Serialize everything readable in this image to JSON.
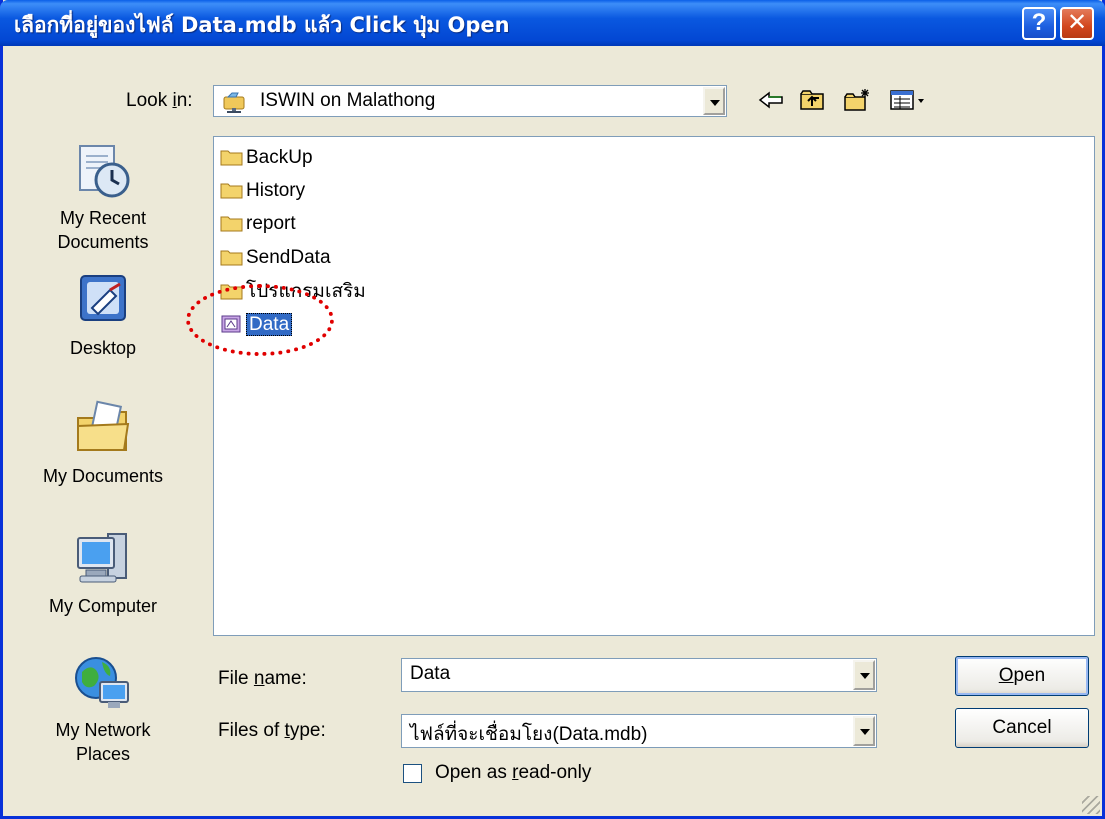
{
  "window": {
    "title": "เลือกที่อยู่ของไฟล์ Data.mdb แล้ว Click ปุ่ม Open",
    "help_glyph": "?",
    "close_glyph": "✕"
  },
  "lookin": {
    "label_pre": "Look ",
    "label_key": "i",
    "label_post": "n:",
    "value": "ISWIN on Malathong"
  },
  "toolbar": {
    "back_icon": "back-arrow-icon",
    "up_icon": "up-folder-icon",
    "new_folder_icon": "new-folder-icon",
    "views_icon": "views-menu-icon"
  },
  "places": [
    {
      "label": "My Recent Documents",
      "line1": "My Recent",
      "line2": "Documents",
      "icon": "recent-documents-icon"
    },
    {
      "label": "Desktop",
      "line1": "Desktop",
      "line2": "",
      "icon": "desktop-icon"
    },
    {
      "label": "My Documents",
      "line1": "My Documents",
      "line2": "",
      "icon": "my-documents-icon"
    },
    {
      "label": "My Computer",
      "line1": "My Computer",
      "line2": "",
      "icon": "my-computer-icon"
    },
    {
      "label": "My Network Places",
      "line1": "My Network",
      "line2": "Places",
      "icon": "network-places-icon"
    }
  ],
  "files": [
    {
      "name": "BackUp",
      "kind": "folder"
    },
    {
      "name": "History",
      "kind": "folder"
    },
    {
      "name": "report",
      "kind": "folder"
    },
    {
      "name": "SendData",
      "kind": "folder"
    },
    {
      "name": "โปรแกรมเสริม",
      "kind": "folder"
    },
    {
      "name": "Data",
      "kind": "database",
      "selected": true
    }
  ],
  "filename": {
    "label_pre": "File ",
    "label_key": "n",
    "label_post": "ame:",
    "value": "Data"
  },
  "filetype": {
    "label_pre": "Files of ",
    "label_key": "t",
    "label_post": "ype:",
    "value": "ไฟล์ที่จะเชื่อมโยง(Data.mdb)"
  },
  "readonly": {
    "label_pre": "Open as ",
    "label_key": "r",
    "label_post": "ead-only",
    "checked": false
  },
  "buttons": {
    "open_key": "O",
    "open_rest": "pen",
    "cancel": "Cancel"
  },
  "colors": {
    "titlebar": "#0a58e0",
    "dialog_bg": "#ece9d8",
    "selection": "#316ac5",
    "highlight_circle": "#e00000"
  }
}
